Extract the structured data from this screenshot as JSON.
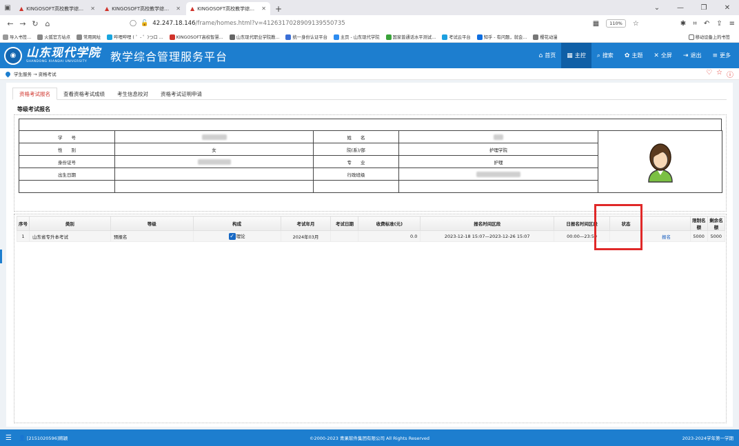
{
  "browser": {
    "tabs": [
      {
        "title": "KINGOSOFT高校教学综合管理",
        "active": false
      },
      {
        "title": "KINGOSOFT高校教学综合管理",
        "active": false
      },
      {
        "title": "KINGOSOFT高校教学综合管理",
        "active": true
      }
    ],
    "address_host": "42.247.18.146",
    "address_path": "/frame/homes.html?v=4126317028909139550735",
    "zoom": "110%",
    "bookmarks": [
      "导入书签...",
      "火狐官方站点",
      "常用网址",
      "哔哩哔哩 ( ゜- ゜)つロ ...",
      "KINGOSOFT高校智慧...",
      "山东现代职业学院教...",
      "统一身份认证平台",
      "主页 - 山东现代学院",
      "国家普通话水平测试...",
      "考试云平台",
      "知乎 - 有问题，就会...",
      "樱花动漫"
    ],
    "bookmark_right": "移动设备上的书签"
  },
  "header": {
    "logo_cn": "山东现代学院",
    "logo_en": "SHANDONG XIANDAI UNIVERSITY",
    "platform_title": "教学综合管理服务平台",
    "nav": [
      {
        "label": "首页",
        "icon": "home-icon",
        "active": false
      },
      {
        "label": "主控",
        "icon": "grid-icon",
        "active": true
      },
      {
        "label": "搜索",
        "icon": "search-icon",
        "active": false
      },
      {
        "label": "主题",
        "icon": "theme-icon",
        "active": false
      },
      {
        "label": "全屏",
        "icon": "fullscreen-icon",
        "active": false
      },
      {
        "label": "退出",
        "icon": "logout-icon",
        "active": false
      },
      {
        "label": "更多",
        "icon": "menu-icon",
        "active": false
      }
    ]
  },
  "breadcrumb": "学生服务 → 资格考试",
  "tabs": [
    "资格考试报名",
    "查看资格考试成绩",
    "考生信息校对",
    "资格考试证明申请"
  ],
  "section_title": "等级考试报名",
  "student": {
    "labels": {
      "student_id": "学　　号",
      "name": "姓　　名",
      "gender": "性　　别",
      "college": "院(系)/部",
      "id_card": "身份证号",
      "major": "专　　业",
      "birth": "出生日期",
      "class": "行政班级"
    },
    "gender": "女",
    "college": "护理学院",
    "major": "护理"
  },
  "exam_table": {
    "headers": [
      "序号",
      "类别",
      "等级",
      "构成",
      "考试年月",
      "考试日期",
      "收费标准(元)",
      "报名时间区段",
      "日报名时间区段",
      "状态",
      "",
      "限制名额",
      "剩余名额"
    ],
    "rows": [
      {
        "index": "1",
        "category": "山东省专升本考试",
        "level": "预报名",
        "component": "理论",
        "exam_month": "2024年03月",
        "exam_date": "",
        "fee": "0.0",
        "period": "2023-12-18 15:07—2023-12-26 15:07",
        "daily_period": "00:00—23:59",
        "status": "",
        "action": "报名",
        "quota": "5000",
        "remaining": "5000"
      }
    ]
  },
  "footer": {
    "user": "[2151020596]韩颖",
    "copyright": "©2000-2023 青果软件集团有限公司 All Rights Reserved",
    "term": "2023-2024学年第一学期"
  },
  "colors": {
    "brand_blue": "#1d7ecf",
    "active_tab_red": "#d0342c",
    "highlight_red": "#e02828",
    "link_blue": "#1a5fc0"
  }
}
